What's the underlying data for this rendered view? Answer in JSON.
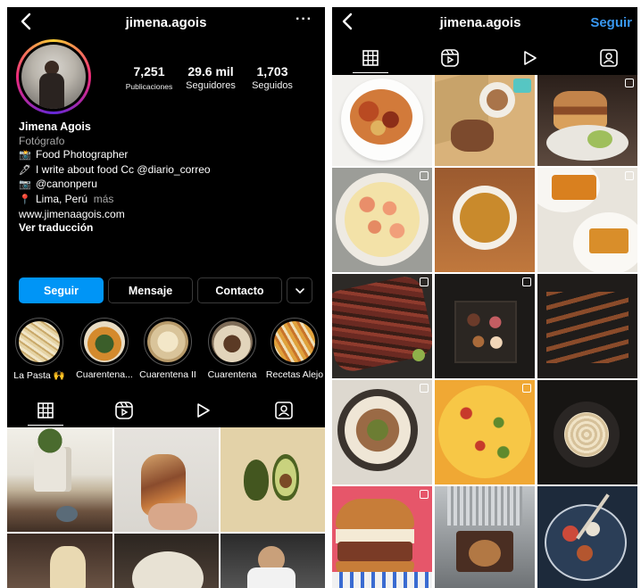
{
  "left": {
    "header": {
      "username": "jimena.agois",
      "more_label": "···"
    },
    "stats": [
      {
        "value": "7,251",
        "label": "Publicaciones"
      },
      {
        "value": "29.6 mil",
        "label": "Seguidores"
      },
      {
        "value": "1,703",
        "label": "Seguidos"
      }
    ],
    "bio": {
      "name": "Jimena Agois",
      "category": "Fotógrafo",
      "lines": [
        {
          "emoji": "📸",
          "text": "Food Photographer"
        },
        {
          "emoji": "🖋",
          "text": "I write about food Cc @diario_correo"
        },
        {
          "emoji": "📷",
          "text": "@canonperu"
        },
        {
          "emoji": "📍",
          "text": "Lima, Perú",
          "suffix": "más"
        }
      ],
      "website": "www.jimenaagois.com",
      "translate": "Ver traducción"
    },
    "buttons": {
      "follow": "Seguir",
      "message": "Mensaje",
      "contact": "Contacto"
    },
    "highlights": [
      {
        "label": "La Pasta 🙌"
      },
      {
        "label": "Cuarentena..."
      },
      {
        "label": "Cuarentena II"
      },
      {
        "label": "Cuarentena"
      },
      {
        "label": "Recetas Alejo"
      }
    ]
  },
  "right": {
    "header": {
      "username": "jimena.agois",
      "follow_label": "Seguir"
    }
  },
  "icons": {
    "back": "chevron-left-icon",
    "more": "more-horizontal-icon",
    "grid": "grid-icon",
    "reels": "reels-icon",
    "video": "play-icon",
    "tagged": "tagged-user-icon"
  },
  "colors": {
    "accent": "#0095f6",
    "follow_link": "#3897f0",
    "background": "#000000"
  }
}
